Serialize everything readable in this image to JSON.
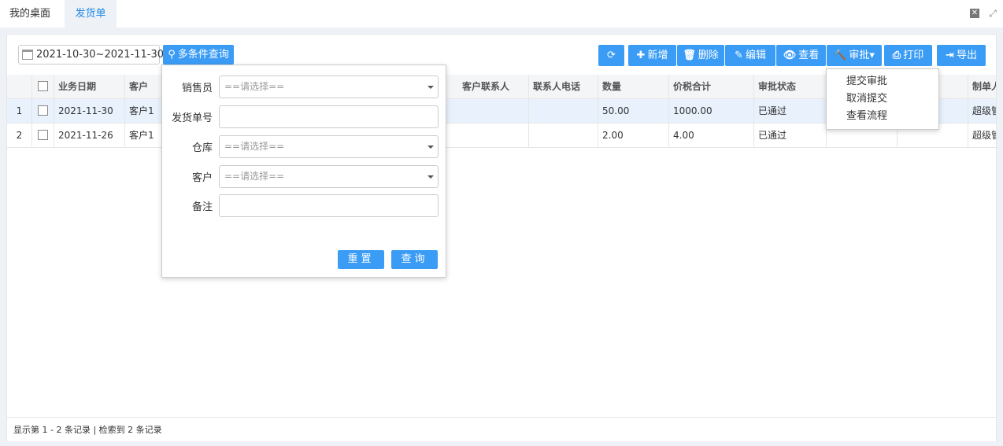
{
  "tabs": [
    {
      "label": "我的桌面"
    },
    {
      "label": "发货单"
    }
  ],
  "window": {
    "close_glyph": "✕",
    "fullscreen_glyph": "⤢"
  },
  "filter": {
    "date_range": "2021-10-30~2021-11-30",
    "query_button": "多条件查询"
  },
  "toolbar": {
    "refresh": "",
    "add": "新增",
    "delete": "删除",
    "edit": "编辑",
    "view": "查看",
    "approve": "审批",
    "print": "打印",
    "export": "导出"
  },
  "icons": {
    "refresh": "⟳",
    "add": "✚",
    "delete": "🗑",
    "edit": "✎",
    "view": "👁",
    "approve": "🔨",
    "print": "⎙",
    "export": "⇥",
    "search": "⚲",
    "approve_caret": "▾"
  },
  "table": {
    "headers": [
      "业务日期",
      "客户",
      "客户联系人",
      "联系人电话",
      "数量",
      "价税合计",
      "审批状态",
      "制单人"
    ],
    "rows": [
      {
        "index": "1",
        "date": "2021-11-30",
        "customer": "客户1",
        "contact": "",
        "phone": "",
        "qty": "50.00",
        "total": "1000.00",
        "status": "已通过",
        "creator": "超级管"
      },
      {
        "index": "2",
        "date": "2021-11-26",
        "customer": "客户1",
        "contact": "",
        "phone": "",
        "qty": "2.00",
        "total": "4.00",
        "status": "已通过",
        "creator": "超级管"
      }
    ]
  },
  "footer": {
    "text": "显示第 1 - 2 条记录 | 检索到 2 条记录"
  },
  "query_form": {
    "fields": [
      {
        "label": "销售员",
        "placeholder": "==请选择=="
      },
      {
        "label": "发货单号",
        "placeholder": ""
      },
      {
        "label": "仓库",
        "placeholder": "==请选择=="
      },
      {
        "label": "客户",
        "placeholder": "==请选择=="
      },
      {
        "label": "备注",
        "placeholder": ""
      }
    ],
    "reset": "重置",
    "submit": "查询"
  },
  "approve_menu": [
    "提交审批",
    "取消提交",
    "查看流程"
  ],
  "colors": {
    "accent": "#3b9cf5",
    "tab_active_text": "#1e88e5",
    "row_selected": "#e8f1fc"
  }
}
